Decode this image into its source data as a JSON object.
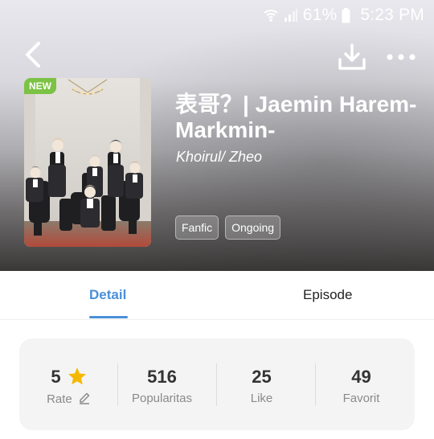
{
  "status_bar": {
    "battery": "61%",
    "time": "5:23 PM"
  },
  "cover": {
    "badge": "NEW"
  },
  "title": "表哥？| Jaemin Harem-Markmin-",
  "author": "Khoirul/ Zheo",
  "tags": [
    "Fanfic",
    "Ongoing"
  ],
  "tabs": {
    "detail": "Detail",
    "episode": "Episode"
  },
  "stats": {
    "rate": {
      "value": "5",
      "label": "Rate"
    },
    "popularitas": {
      "value": "516",
      "label": "Popularitas"
    },
    "like": {
      "value": "25",
      "label": "Like"
    },
    "favorit": {
      "value": "49",
      "label": "Favorit"
    }
  },
  "colors": {
    "accent": "#4a90d9",
    "new_badge": "#7cc245",
    "star": "#f5b800"
  },
  "icons": [
    "wifi-icon",
    "signal-icon",
    "battery-icon",
    "back-arrow-icon",
    "download-icon",
    "more-icon",
    "star-icon",
    "edit-icon"
  ]
}
